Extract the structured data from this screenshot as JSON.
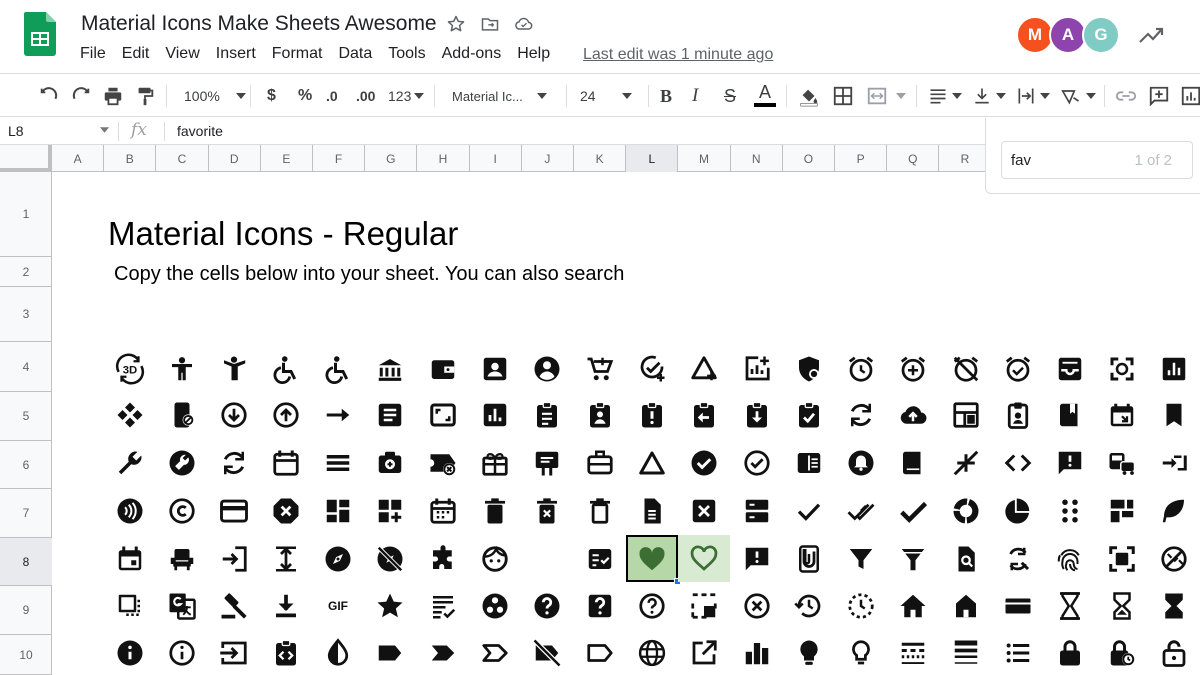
{
  "doc": {
    "title": "Material Icons Make Sheets Awesome",
    "last_edit": "Last edit was 1 minute ago"
  },
  "menu": [
    "File",
    "Edit",
    "View",
    "Insert",
    "Format",
    "Data",
    "Tools",
    "Add-ons",
    "Help"
  ],
  "avatars": [
    {
      "initial": "M",
      "color": "#f4511e"
    },
    {
      "initial": "A",
      "color": "#8e44ad"
    },
    {
      "initial": "G",
      "color": "#80cbc4"
    }
  ],
  "toolbar": {
    "zoom": "100%",
    "currency": "$",
    "percent": "%",
    "dec_decrease": ".0",
    "dec_increase": ".00",
    "more_formats": "123",
    "font": "Material Ic...",
    "font_size": "24",
    "bold": "B",
    "italic": "I",
    "strike": "S",
    "text_color": "A"
  },
  "formula_bar": {
    "cell_ref": "L8",
    "fx": "fx",
    "value": "favorite"
  },
  "find": {
    "query": "fav",
    "count": "1 of 2"
  },
  "columns": [
    "A",
    "B",
    "C",
    "D",
    "E",
    "F",
    "G",
    "H",
    "I",
    "J",
    "K",
    "L",
    "M",
    "N",
    "O",
    "P",
    "Q",
    "R"
  ],
  "active_column": "L",
  "rows": [
    "1",
    "2",
    "3",
    "4",
    "5",
    "6",
    "7",
    "8",
    "9",
    "10"
  ],
  "active_row": "8",
  "sheet": {
    "title": "Material Icons - Regular",
    "subtitle": "Copy the cells below into your sheet. You can also search"
  },
  "selected_cell_value": "favorite",
  "gif_label": "GIF"
}
